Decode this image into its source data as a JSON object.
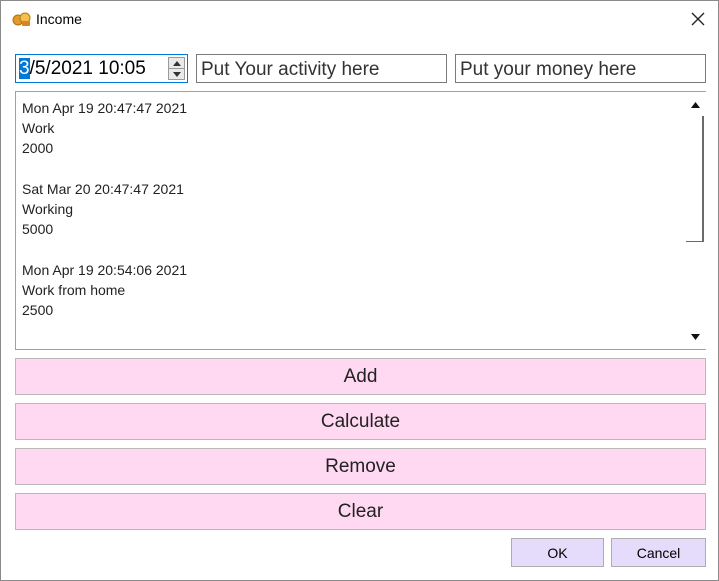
{
  "window": {
    "title": "Income",
    "app_icon": "coins-icon",
    "close_icon": "close-icon"
  },
  "inputs": {
    "datetime_selected": "3",
    "datetime_rest": "/5/2021 10:05",
    "activity_placeholder": "Put Your activity here",
    "money_placeholder": "Put your money here"
  },
  "entries": [
    {
      "date": "Mon Apr 19 20:47:47 2021",
      "activity": "Work",
      "amount": "2000"
    },
    {
      "date": "Sat Mar 20 20:47:47 2021",
      "activity": "Working",
      "amount": "5000"
    },
    {
      "date": "Mon Apr 19 20:54:06 2021",
      "activity": "Work from home",
      "amount": "2500"
    }
  ],
  "buttons": {
    "add": "Add",
    "calculate": "Calculate",
    "remove": "Remove",
    "clear": "Clear",
    "ok": "OK",
    "cancel": "Cancel"
  },
  "colors": {
    "action_button": "#ffd9f2",
    "dialog_button": "#e5dcfb",
    "focus": "#0078d7"
  }
}
